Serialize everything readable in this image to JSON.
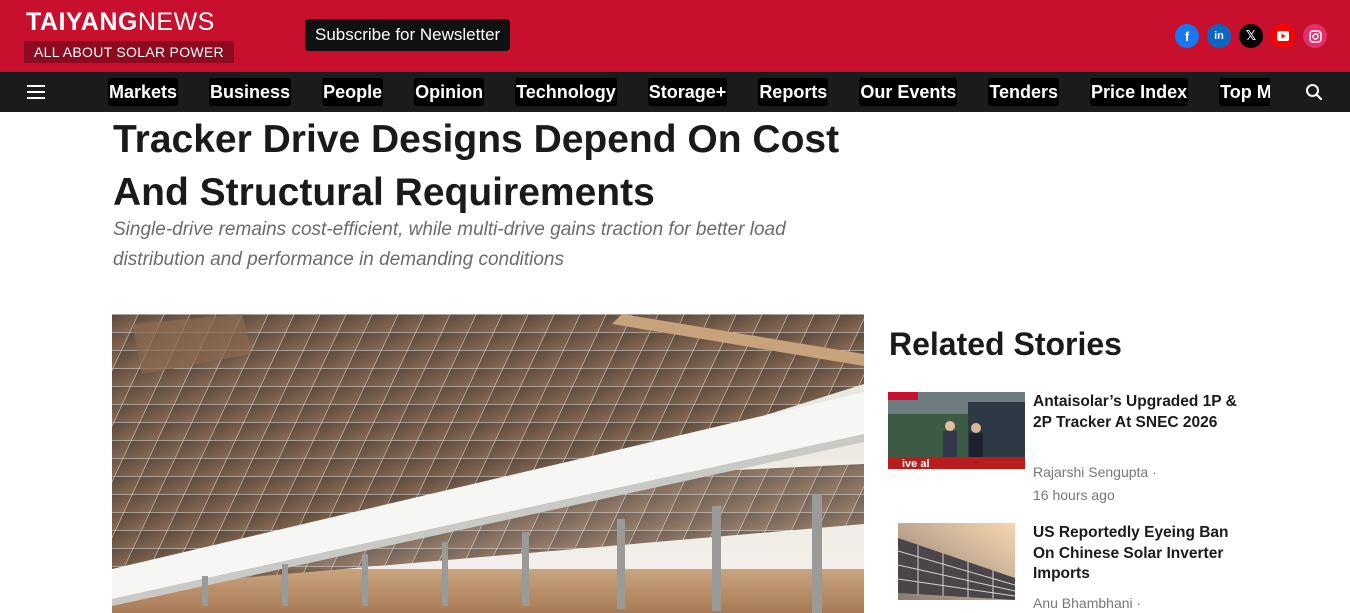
{
  "header": {
    "logo_brand": "TAIYANG",
    "logo_news": "NEWS",
    "logo_tagline": "ALL ABOUT SOLAR POWER",
    "subscribe_label": "Subscribe for Newsletter",
    "brand_color": "#c8102e",
    "socials": [
      "facebook-icon",
      "linkedin-icon",
      "x-icon",
      "youtube-icon",
      "instagram-icon"
    ]
  },
  "nav": {
    "items": [
      {
        "label": "Markets"
      },
      {
        "label": "Business"
      },
      {
        "label": "People"
      },
      {
        "label": "Opinion"
      },
      {
        "label": "Technology"
      },
      {
        "label": "Storage+"
      },
      {
        "label": "Reports"
      },
      {
        "label": "Our Events"
      },
      {
        "label": "Tenders"
      },
      {
        "label": "Price Index"
      },
      {
        "label": "Top Mod"
      }
    ]
  },
  "article": {
    "title": "Tracker Drive Designs Depend On Cost And Structural Requirements",
    "subtitle": "Single-drive remains cost-efficient, while multi-drive gains traction for better load distribution and performance in demanding conditions"
  },
  "sidebar": {
    "heading": "Related Stories",
    "stories": [
      {
        "title": "Antaisolar’s Upgraded 1P & 2P Tracker At SNEC 2026",
        "author": "Rajarshi Sengupta",
        "separator": "·",
        "time": "16 hours ago"
      },
      {
        "title": "US Reportedly Eyeing Ban On Chinese Solar Inverter Imports",
        "author": "Anu Bhambhani",
        "separator": "·"
      }
    ]
  }
}
